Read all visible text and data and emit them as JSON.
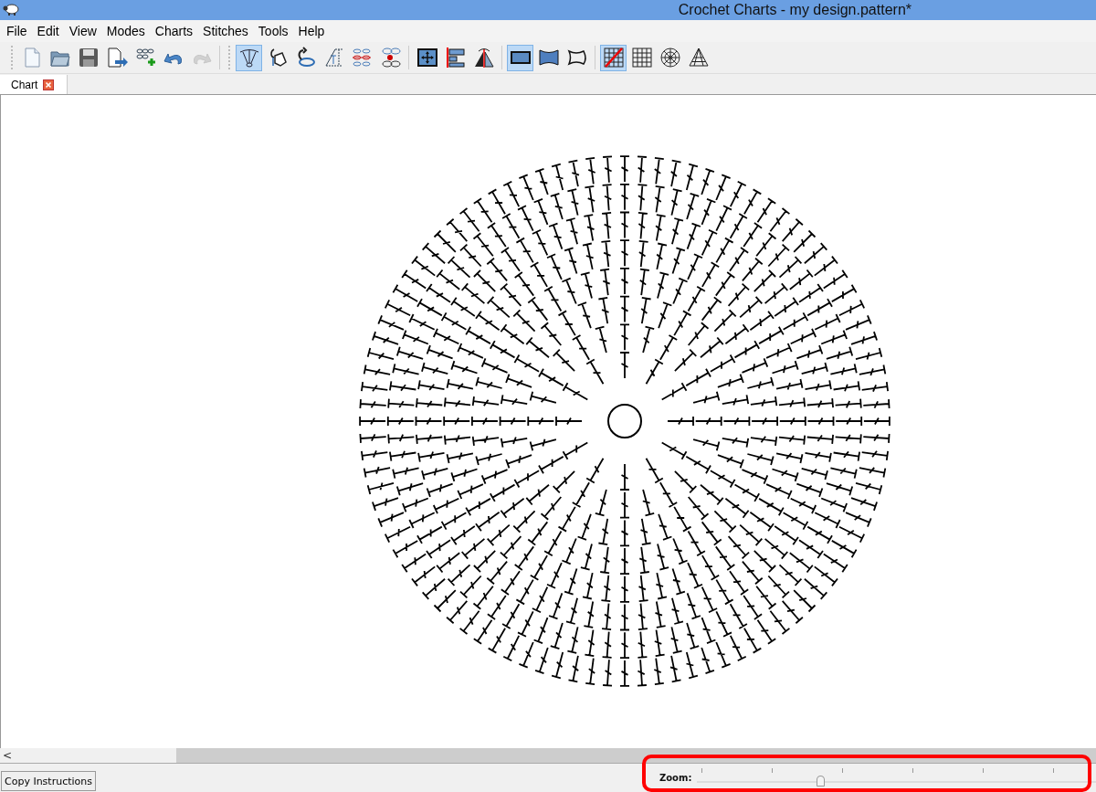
{
  "window": {
    "title": "Crochet Charts - my design.pattern*"
  },
  "menu": [
    "File",
    "Edit",
    "View",
    "Modes",
    "Charts",
    "Stitches",
    "Tools",
    "Help"
  ],
  "toolbar": [
    [
      {
        "kind": "new",
        "selected": false,
        "disabled": false
      },
      {
        "kind": "open",
        "selected": false,
        "disabled": false
      },
      {
        "kind": "save",
        "selected": false,
        "disabled": false
      },
      {
        "kind": "export",
        "selected": false,
        "disabled": false
      },
      {
        "kind": "addrows",
        "selected": false,
        "disabled": false
      },
      {
        "kind": "undo",
        "selected": false,
        "disabled": false
      },
      {
        "kind": "redo",
        "selected": false,
        "disabled": true
      }
    ],
    [
      {
        "kind": "fan",
        "selected": true,
        "disabled": false
      },
      {
        "kind": "bucket",
        "selected": false,
        "disabled": false
      },
      {
        "kind": "rotate",
        "selected": false,
        "disabled": false
      },
      {
        "kind": "stitch",
        "selected": false,
        "disabled": false
      },
      {
        "kind": "chains",
        "selected": false,
        "disabled": false
      },
      {
        "kind": "marker",
        "selected": false,
        "disabled": false
      }
    ],
    [
      {
        "kind": "move",
        "selected": false,
        "disabled": false
      },
      {
        "kind": "align",
        "selected": false,
        "disabled": false
      },
      {
        "kind": "mirror",
        "selected": false,
        "disabled": false
      }
    ],
    [
      {
        "kind": "rect",
        "selected": true,
        "disabled": false
      },
      {
        "kind": "wave",
        "selected": false,
        "disabled": false
      },
      {
        "kind": "outline",
        "selected": false,
        "disabled": false
      }
    ],
    [
      {
        "kind": "nogrid",
        "selected": true,
        "disabled": false
      },
      {
        "kind": "grid",
        "selected": false,
        "disabled": false
      },
      {
        "kind": "polar",
        "selected": false,
        "disabled": false
      },
      {
        "kind": "tri",
        "selected": false,
        "disabled": false
      }
    ]
  ],
  "tabs": [
    {
      "label": "Chart",
      "selected": true
    }
  ],
  "scrollbar": {
    "left_arrow": "<"
  },
  "bottom_bar": {
    "button": "Copy Instructions",
    "zoom": {
      "label": "Zoom:",
      "level": 0.31
    }
  }
}
